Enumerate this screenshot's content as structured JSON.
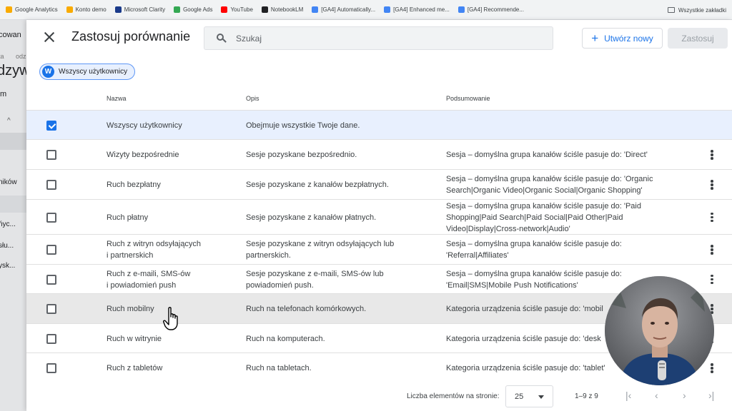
{
  "bookmarks": [
    {
      "label": "Google Analytics",
      "color": "#f9ab00"
    },
    {
      "label": "Konto demo",
      "color": "#f9ab00"
    },
    {
      "label": "Microsoft Clarity",
      "color": "#1a3a8a"
    },
    {
      "label": "Google Ads",
      "color": "#34a853"
    },
    {
      "label": "YouTube",
      "color": "#ff0000"
    },
    {
      "label": "NotebookLM",
      "color": "#202124"
    },
    {
      "label": "[GA4] Automatically...",
      "color": "#4285f4"
    },
    {
      "label": "[GA4] Enhanced me...",
      "color": "#4285f4"
    },
    {
      "label": "[GA4] Recommende...",
      "color": "#4285f4"
    }
  ],
  "bookmarks_folder": "Wszystkie zakładki",
  "backdrop": {
    "texts": [
      "cowan",
      "ta",
      "odz",
      "dzyw",
      "m",
      "ników",
      "ńyc...",
      "słu...",
      "ysk..."
    ]
  },
  "panel": {
    "title": "Zastosuj porównanie",
    "search_placeholder": "Szukaj",
    "create_label": "Utwórz nowy",
    "create_icon": "plus-icon",
    "apply_label": "Zastosuj"
  },
  "chip": {
    "initial": "W",
    "label": "Wszyscy użytkownicy"
  },
  "table": {
    "headers": [
      "Nazwa",
      "Opis",
      "Podsumowanie"
    ],
    "rows": [
      {
        "name": [
          "Wszyscy użytkownicy"
        ],
        "desc": [
          "Obejmuje wszystkie Twoje dane."
        ],
        "summary": [],
        "checked": true,
        "menu": false
      },
      {
        "name": [
          "Wizyty bezpośrednie"
        ],
        "desc": [
          "Sesje pozyskane bezpośrednio."
        ],
        "summary": [
          "Sesja – domyślna grupa kanałów ściśle pasuje do: 'Direct'"
        ],
        "checked": false,
        "menu": true
      },
      {
        "name": [
          "Ruch bezpłatny"
        ],
        "desc": [
          "Sesje pozyskane z kanałów bezpłatnych."
        ],
        "summary": [
          "Sesja – domyślna grupa kanałów ściśle pasuje do: 'Organic",
          "Search|Organic Video|Organic Social|Organic Shopping'"
        ],
        "checked": false,
        "menu": true
      },
      {
        "name": [
          "Ruch płatny"
        ],
        "desc": [
          "Sesje pozyskane z kanałów płatnych."
        ],
        "summary": [
          "Sesja – domyślna grupa kanałów ściśle pasuje do: 'Paid",
          "Shopping|Paid Search|Paid Social|Paid Other|Paid",
          "Video|Display|Cross-network|Audio'"
        ],
        "checked": false,
        "menu": true
      },
      {
        "name": [
          "Ruch z witryn odsyłających",
          "i partnerskich"
        ],
        "desc": [
          "Sesje pozyskane z witryn odsyłających lub",
          "partnerskich."
        ],
        "summary": [
          "Sesja – domyślna grupa kanałów ściśle pasuje do:",
          "'Referral|Affiliates'"
        ],
        "checked": false,
        "menu": true
      },
      {
        "name": [
          "Ruch z e-maili, SMS-ów",
          "i powiadomień push"
        ],
        "desc": [
          "Sesje pozyskane z e-maili, SMS-ów lub",
          "powiadomień push."
        ],
        "summary": [
          "Sesja – domyślna grupa kanałów ściśle pasuje do:",
          "'Email|SMS|Mobile Push Notifications'"
        ],
        "checked": false,
        "menu": true
      },
      {
        "name": [
          "Ruch mobilny"
        ],
        "desc": [
          "Ruch na telefonach komórkowych."
        ],
        "summary": [
          "Kategoria urządzenia ściśle pasuje do: 'mobil"
        ],
        "checked": false,
        "menu": true
      },
      {
        "name": [
          "Ruch w witrynie"
        ],
        "desc": [
          "Ruch na komputerach."
        ],
        "summary": [
          "Kategoria urządzenia ściśle pasuje do: 'desk"
        ],
        "checked": false,
        "menu": true
      },
      {
        "name": [
          "Ruch z tabletów"
        ],
        "desc": [
          "Ruch na tabletach."
        ],
        "summary": [
          "Kategoria urządzenia ściśle pasuje do: 'tablet'"
        ],
        "checked": false,
        "menu": true
      }
    ]
  },
  "footer": {
    "per_page_label": "Liczba elementów na stronie:",
    "per_page_value": "25",
    "range": "1–9 z 9",
    "nav_icons": [
      "first-page-icon",
      "prev-page-icon",
      "next-page-icon",
      "last-page-icon"
    ]
  },
  "colors": {
    "accent": "#1a73e8",
    "selected_row": "#e8f0fe",
    "hover_row": "#e8e8e8"
  }
}
